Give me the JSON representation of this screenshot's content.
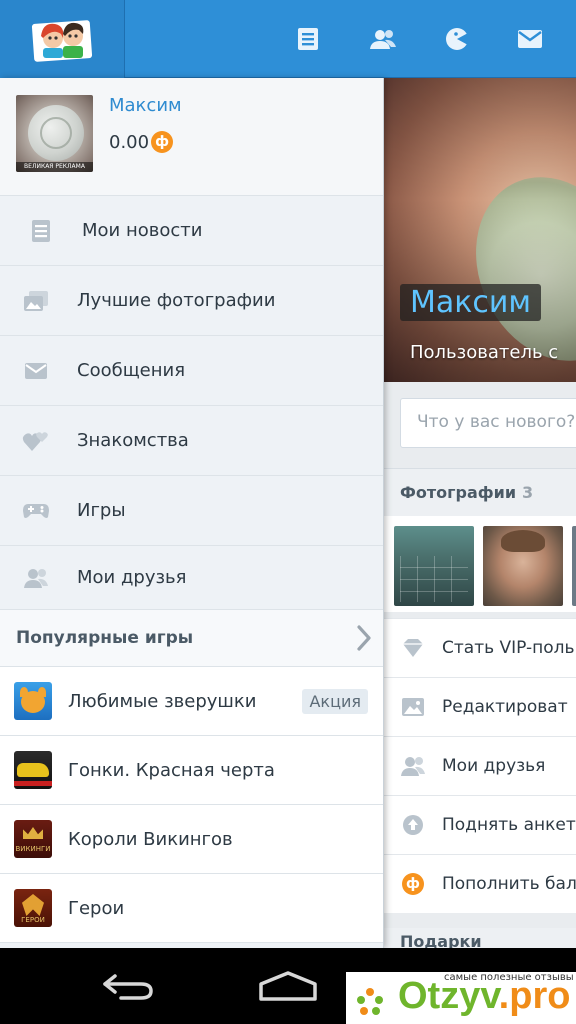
{
  "app": {
    "topbar": {
      "icons": [
        "news-icon",
        "friends-icon",
        "games-icon",
        "messages-icon"
      ]
    }
  },
  "drawer": {
    "user": {
      "name": "Максим",
      "balance": "0.00",
      "currency_symbol": "ф",
      "avatar_caption": "ВЕЛИКАЯ РЕКЛАМА"
    },
    "items": [
      {
        "label": "Мои новости",
        "icon": "news-icon"
      },
      {
        "label": "Лучшие фотографии",
        "icon": "photos-icon"
      },
      {
        "label": "Сообщения",
        "icon": "envelope-icon"
      },
      {
        "label": "Знакомства",
        "icon": "hearts-icon"
      },
      {
        "label": "Игры",
        "icon": "gamepad-icon"
      },
      {
        "label": "Мои друзья",
        "icon": "friends-icon"
      }
    ],
    "games_section": {
      "title": "Популярные игры",
      "games": [
        {
          "label": "Любимые зверушки",
          "badge": "Акция",
          "icon": "pets-game-icon"
        },
        {
          "label": "Гонки. Красная черта",
          "icon": "race-game-icon"
        },
        {
          "label": "Короли Викингов",
          "icon": "vikings-game-icon",
          "icon_text": "ВИКИНГИ"
        },
        {
          "label": "Герои",
          "icon": "heroes-game-icon",
          "icon_text": "ГЕРОИ"
        }
      ]
    }
  },
  "profile": {
    "cover_name": "Максим",
    "cover_subtitle": "Пользователь с",
    "status_placeholder": "Что у вас нового?",
    "photos_title": "Фотографии",
    "photos_count": "3",
    "menu": [
      {
        "label": "Стать VIP-поль",
        "icon": "diamond-icon"
      },
      {
        "label": "Редактироват",
        "icon": "picture-icon"
      },
      {
        "label": "Мои друзья",
        "icon": "friends-icon"
      },
      {
        "label": "Поднять анкет",
        "icon": "raise-icon"
      },
      {
        "label": "Пополнить бал",
        "icon": "coin-icon"
      }
    ],
    "gifts_title": "Подарки"
  },
  "system_nav": {
    "buttons": [
      "back-icon",
      "home-icon"
    ]
  },
  "watermark": {
    "tagline": "самые полезные отзывы",
    "brand_main": "Otzyv",
    "brand_tld": ".pro"
  },
  "colors": {
    "topbar": "#2e8fd7",
    "accent_blue": "#2f8bd0",
    "coin_orange": "#f7931e"
  }
}
